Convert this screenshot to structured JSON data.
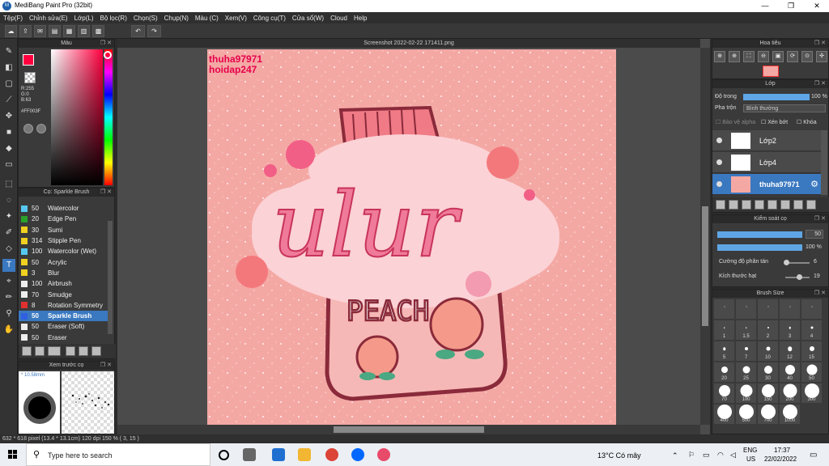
{
  "app": {
    "title": "MediBang Paint Pro (32bit)",
    "minimize": "—",
    "maximize": "❐",
    "close": "✕"
  },
  "menu": [
    "Tệp(F)",
    "Chỉnh sửa(E)",
    "Lớp(L)",
    "Bộ lọc(R)",
    "Chọn(S)",
    "Chụp(N)",
    "Màu (C)",
    "Xem(V)",
    "Công cụ(T)",
    "Cửa sổ(W)",
    "Cloud",
    "Help"
  ],
  "color_panel": {
    "title": "Màu",
    "rgb": [
      "R:255",
      "G:0",
      "B:63"
    ],
    "hex": "#FF003F",
    "fg_color": "#ff003f"
  },
  "brush_panel": {
    "title": "Cọ: Sparkle Brush",
    "brushes": [
      {
        "size": "50",
        "name": "Watercolor",
        "color": "#56c8f0"
      },
      {
        "size": "20",
        "name": "Edge Pen",
        "color": "#2aa12a"
      },
      {
        "size": "30",
        "name": "Sumi",
        "color": "#f0d020"
      },
      {
        "size": "314",
        "name": "Stipple Pen",
        "color": "#f0d020"
      },
      {
        "size": "100",
        "name": "Watercolor (Wet)",
        "color": "#56c8f0"
      },
      {
        "size": "50",
        "name": "Acrylic",
        "color": "#f0d020"
      },
      {
        "size": "3",
        "name": "Blur",
        "color": "#f0d020"
      },
      {
        "size": "100",
        "name": "Airbrush",
        "color": "#eeeeee"
      },
      {
        "size": "70",
        "name": "Smudge",
        "color": "#eeeeee"
      },
      {
        "size": "8",
        "name": "Rotation Symmetry",
        "color": "#e03030"
      },
      {
        "size": "50",
        "name": "Sparkle Brush",
        "color": "#3060e0",
        "selected": true
      },
      {
        "size": "50",
        "name": "Eraser (Soft)",
        "color": "#eeeeee"
      },
      {
        "size": "50",
        "name": "Eraser",
        "color": "#eeeeee"
      }
    ]
  },
  "preview_panel": {
    "title": "Xem trước cọ",
    "size_label": "* 10.58mm"
  },
  "document": {
    "title": "Screenshot 2022-02-22 171411.png",
    "watermark_1": "thuha97971",
    "watermark_2": "hoidap247",
    "art_word": "ulur",
    "art_label": "PEACH"
  },
  "navigator": {
    "title": "Hoa tiêu"
  },
  "layer_panel": {
    "title": "Lớp",
    "opacity_label": "Độ trong",
    "opacity_value": "100 %",
    "opacity_fraction": 1.0,
    "blend_label": "Pha trộn",
    "blend_value": "Bình thường",
    "opt_alpha": "Bảo vệ alpha",
    "opt_clip": "Xén bớt",
    "opt_lock": "Khóa",
    "layers": [
      {
        "name": "Lớp2",
        "selected": false
      },
      {
        "name": "Lớp4",
        "selected": false
      },
      {
        "name": "thuha97971",
        "selected": true
      }
    ]
  },
  "brush_control": {
    "title": "Kiểm soát cọ",
    "size_value": "50",
    "opacity_value": "100 %",
    "scatter_label": "Cường độ phân tán",
    "scatter_value": "6",
    "particle_label": "Kích thước hạt",
    "particle_value": "19"
  },
  "brush_size": {
    "title": "Brush Size",
    "sizes": [
      "",
      "",
      "",
      "",
      "",
      "1",
      "1.5",
      "2",
      "3",
      "4",
      "5",
      "7",
      "10",
      "12",
      "15",
      "20",
      "25",
      "30",
      "40",
      "50",
      "70",
      "100",
      "150",
      "200",
      "300",
      "400",
      "500",
      "700",
      "1000"
    ]
  },
  "status": {
    "text": "632 * 618 pixel    (13.4 * 13.1cm)    120 dpi    150 %    ( 3, 15 )"
  },
  "taskbar": {
    "search_placeholder": "Type here to search",
    "weather": "13°C  Có mây",
    "lang_1": "ENG",
    "lang_2": "US",
    "time": "17:37",
    "date": "22/02/2022"
  }
}
